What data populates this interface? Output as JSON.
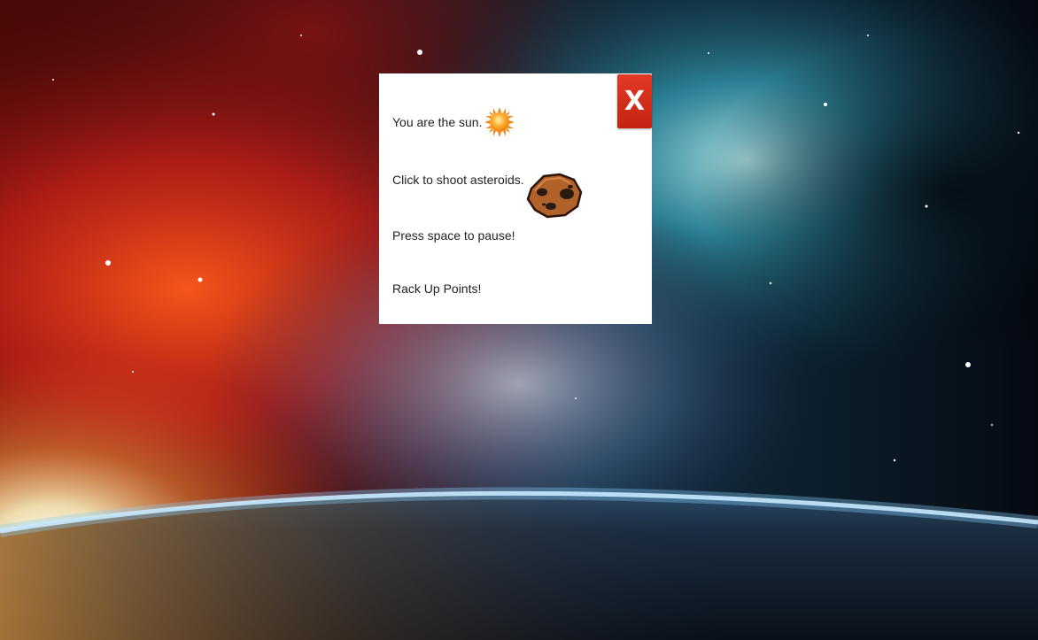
{
  "modal": {
    "close_label": "X",
    "lines": [
      {
        "text": "You are the sun.",
        "icon": "sun-icon"
      },
      {
        "text": "Click to shoot asteroids.",
        "icon": "asteroid-icon"
      },
      {
        "text": "Press space to pause!"
      },
      {
        "text": "Rack Up Points!"
      }
    ]
  },
  "colors": {
    "close_button": "#d32f1d",
    "modal_background": "#ffffff",
    "text": "#222222"
  },
  "background": "space-nebula-with-planet-horizon"
}
